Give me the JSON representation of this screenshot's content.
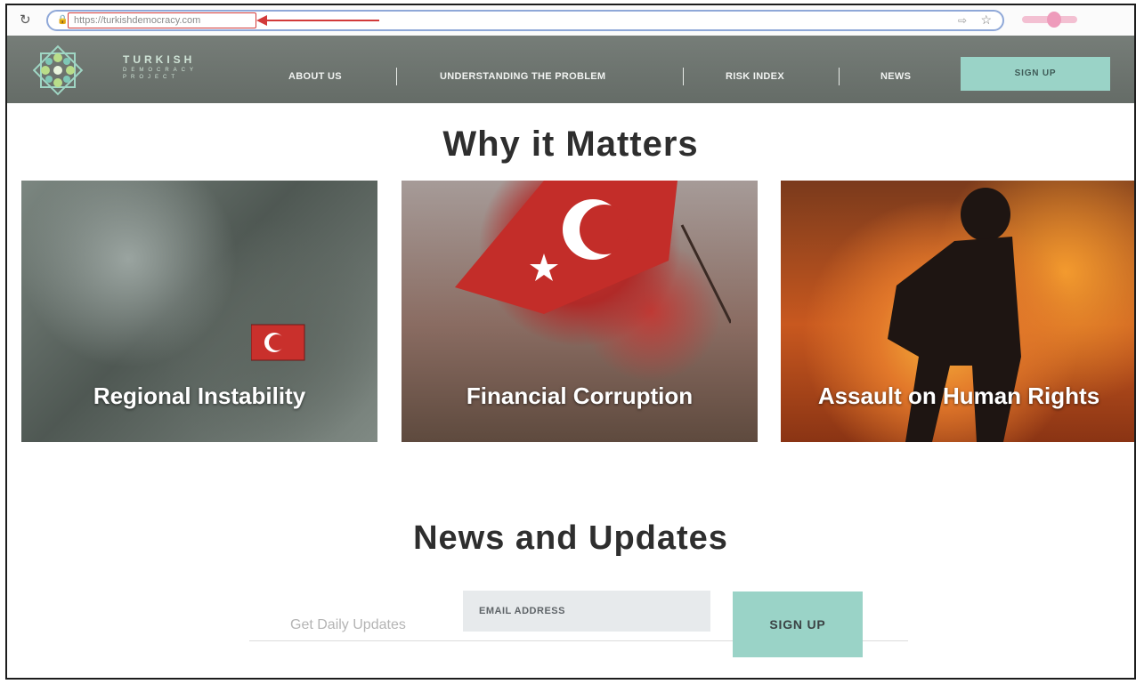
{
  "browser": {
    "url": "https://turkishdemocracy.com"
  },
  "site": {
    "logo_line1": "TURKISH",
    "logo_line2": "DEMOCRACY",
    "logo_line3": "PROJECT",
    "nav": [
      {
        "label": "ABOUT US"
      },
      {
        "label": "UNDERSTANDING THE PROBLEM"
      },
      {
        "label": "RISK INDEX"
      },
      {
        "label": "NEWS"
      }
    ],
    "signup_label": "SIGN UP"
  },
  "why": {
    "heading": "Why it Matters",
    "cards": [
      {
        "title": "Regional Instability"
      },
      {
        "title": "Financial Corruption"
      },
      {
        "title": "Assault on Human Rights"
      }
    ]
  },
  "news": {
    "heading": "News and Updates",
    "daily_label": "Get Daily Updates",
    "email_placeholder": "EMAIL ADDRESS",
    "signup_label": "SIGN UP"
  },
  "colors": {
    "nav_bg": "#6e7570",
    "accent": "#9ad3c7",
    "url_highlight": "#d23a3a"
  },
  "icons": [
    "reload-icon",
    "lock-icon",
    "share-icon",
    "star-icon",
    "logo-mark-icon"
  ]
}
